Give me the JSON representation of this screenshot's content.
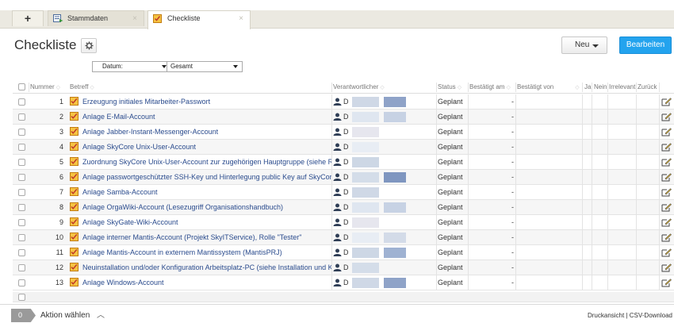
{
  "tabs": {
    "plus_label": "+",
    "items": [
      {
        "label": "Stammdaten",
        "active": false
      },
      {
        "label": "Checkliste",
        "active": true
      }
    ],
    "close_glyph": "×"
  },
  "header": {
    "title": "Checkliste",
    "settings_icon": "gear-icon",
    "new_label": "Neu",
    "edit_label": "Bearbeiten"
  },
  "filters": {
    "date_value": "Datum:",
    "scope_value": "Gesamt"
  },
  "table": {
    "columns": {
      "nummer": "Nummer",
      "betreff": "Betreff",
      "verantwortlicher": "Verantwortlicher",
      "status": "Status",
      "bestaetigt_am": "Bestätigt am",
      "bestaetigt_von": "Bestätigt von",
      "ja": "Ja",
      "nein": "Nein",
      "irrelevant": "Irrelevant",
      "zurueck": "Zurück"
    },
    "rows": [
      {
        "nummer": "1",
        "betreff": "Erzeugung initiales Mitarbeiter-Passwort",
        "verantwortlicher": "D",
        "status": "Geplant",
        "bestaetigt_am": "-"
      },
      {
        "nummer": "2",
        "betreff": "Anlage E-Mail-Account",
        "verantwortlicher": "D",
        "status": "Geplant",
        "bestaetigt_am": "-"
      },
      {
        "nummer": "3",
        "betreff": "Anlage Jabber-Instant-Messenger-Account",
        "verantwortlicher": "D",
        "status": "Geplant",
        "bestaetigt_am": "-"
      },
      {
        "nummer": "4",
        "betreff": "Anlage SkyCore Unix-User-Account",
        "verantwortlicher": "D",
        "status": "Geplant",
        "bestaetigt_am": "-"
      },
      {
        "nummer": "5",
        "betreff": "Zuordnung SkyCore Unix-User-Account zur zugehörigen Hauptgruppe (siehe Reg...",
        "verantwortlicher": "D",
        "status": "Geplant",
        "bestaetigt_am": "-"
      },
      {
        "nummer": "6",
        "betreff": "Anlage passwortgeschützter SSH-Key und Hinterlegung public Key auf SkyCore",
        "verantwortlicher": "D",
        "status": "Geplant",
        "bestaetigt_am": "-"
      },
      {
        "nummer": "7",
        "betreff": "Anlage Samba-Account",
        "verantwortlicher": "D",
        "status": "Geplant",
        "bestaetigt_am": "-"
      },
      {
        "nummer": "8",
        "betreff": "Anlage OrgaWiki-Account (Lesezugriff Organisationshandbuch)",
        "verantwortlicher": "D",
        "status": "Geplant",
        "bestaetigt_am": "-"
      },
      {
        "nummer": "9",
        "betreff": "Anlage SkyGate-Wiki-Account",
        "verantwortlicher": "D",
        "status": "Geplant",
        "bestaetigt_am": "-"
      },
      {
        "nummer": "10",
        "betreff": "Anlage interner Mantis-Account (Projekt SkyITService), Rolle \"Tester\"",
        "verantwortlicher": "D",
        "status": "Geplant",
        "bestaetigt_am": "-"
      },
      {
        "nummer": "11",
        "betreff": "Anlage Mantis-Account in externem Mantissystem (MantisPRJ)",
        "verantwortlicher": "D",
        "status": "Geplant",
        "bestaetigt_am": "-"
      },
      {
        "nummer": "12",
        "betreff": "Neuinstallation und/oder Konfiguration Arbeitsplatz-PC (siehe Installation und Ko...",
        "verantwortlicher": "D",
        "status": "Geplant",
        "bestaetigt_am": "-"
      },
      {
        "nummer": "13",
        "betreff": "Anlage Windows-Account",
        "verantwortlicher": "D",
        "status": "Geplant",
        "bestaetigt_am": "-"
      }
    ]
  },
  "footer": {
    "selected_count": "0",
    "action_label": "Aktion wählen",
    "links": "Druckansicht | CSV-Download"
  },
  "colors": {
    "primary_button": "#23a3ee",
    "link_text": "#2a4b8d",
    "tab_strip": "#ebe9e1"
  }
}
